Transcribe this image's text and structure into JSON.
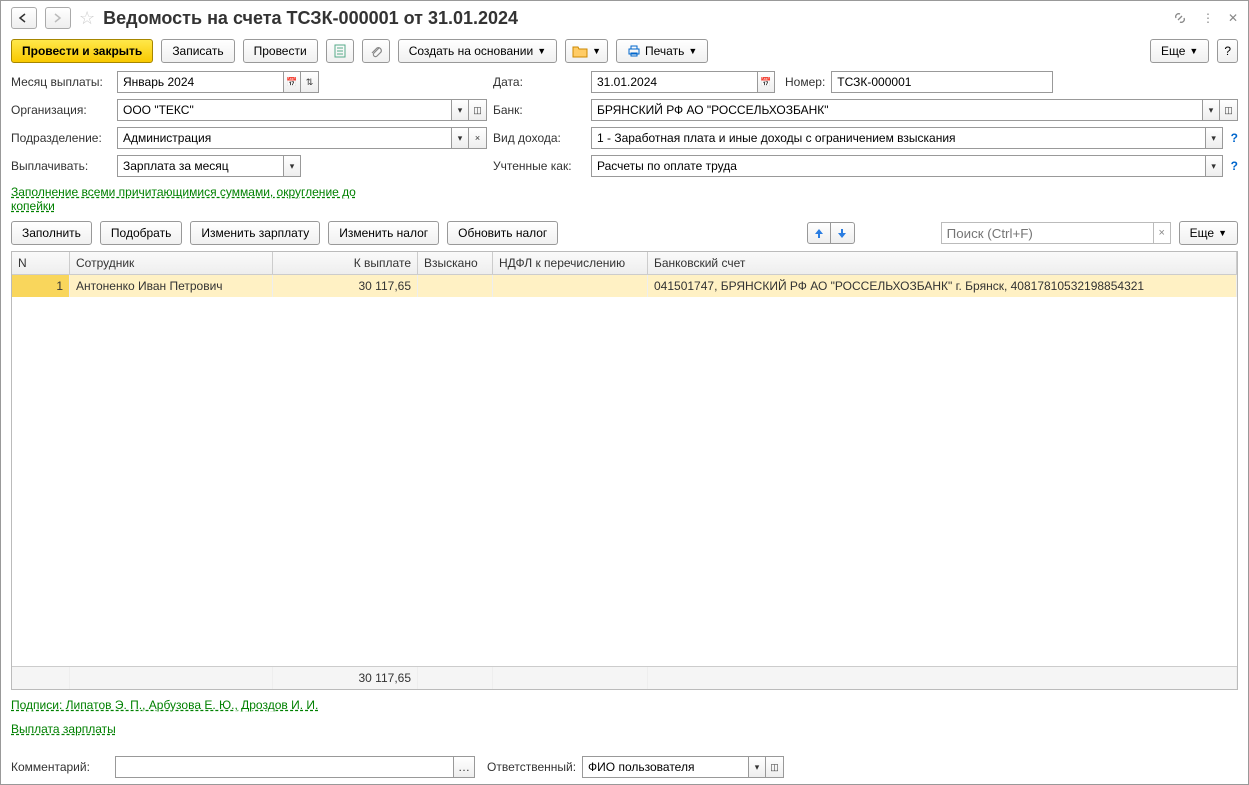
{
  "title": "Ведомость на счета ТСЗК-000001 от 31.01.2024",
  "toolbar": {
    "post_close": "Провести и закрыть",
    "write": "Записать",
    "post": "Провести",
    "create_base": "Создать на основании",
    "print": "Печать",
    "more": "Еще",
    "more2": "Еще"
  },
  "form": {
    "month_label": "Месяц выплаты:",
    "month_value": "Январь 2024",
    "date_label": "Дата:",
    "date_value": "31.01.2024",
    "number_label": "Номер:",
    "number_value": "ТСЗК-000001",
    "org_label": "Организация:",
    "org_value": "ООО \"ТЕКС\"",
    "bank_label": "Банк:",
    "bank_value": "БРЯНСКИЙ РФ АО \"РОССЕЛЬХОЗБАНК\"",
    "dept_label": "Подразделение:",
    "dept_value": "Администрация",
    "income_label": "Вид дохода:",
    "income_value": "1 - Заработная плата и иные доходы с ограничением взыскания",
    "pay_label": "Выплачивать:",
    "pay_value": "Зарплата за месяц",
    "account_label": "Учтенные как:",
    "account_value": "Расчеты по оплате труда",
    "fill_link": "Заполнение всеми причитающимися суммами, округление до копейки"
  },
  "table_toolbar": {
    "fill": "Заполнить",
    "pick": "Подобрать",
    "change_salary": "Изменить зарплату",
    "change_tax": "Изменить налог",
    "update_tax": "Обновить налог",
    "search_placeholder": "Поиск (Ctrl+F)"
  },
  "table": {
    "headers": [
      "N",
      "Сотрудник",
      "К выплате",
      "Взыскано",
      "НДФЛ к перечислению",
      "Банковский счет"
    ],
    "rows": [
      {
        "n": "1",
        "employee": "Антоненко Иван Петрович",
        "to_pay": "30 117,65",
        "withheld": "",
        "ndfl": "",
        "account": "041501747, БРЯНСКИЙ РФ АО \"РОССЕЛЬХОЗБАНК\" г. Брянск, 40817810532198854321"
      }
    ],
    "footer_pay": "30 117,65"
  },
  "links": {
    "signatures": "Подписи: Липатов Э. П., Арбузова Е. Ю., Дроздов И. И.",
    "payout": "Выплата зарплаты"
  },
  "footer": {
    "comment_label": "Комментарий:",
    "responsible_label": "Ответственный:",
    "responsible_value": "ФИО пользователя"
  }
}
